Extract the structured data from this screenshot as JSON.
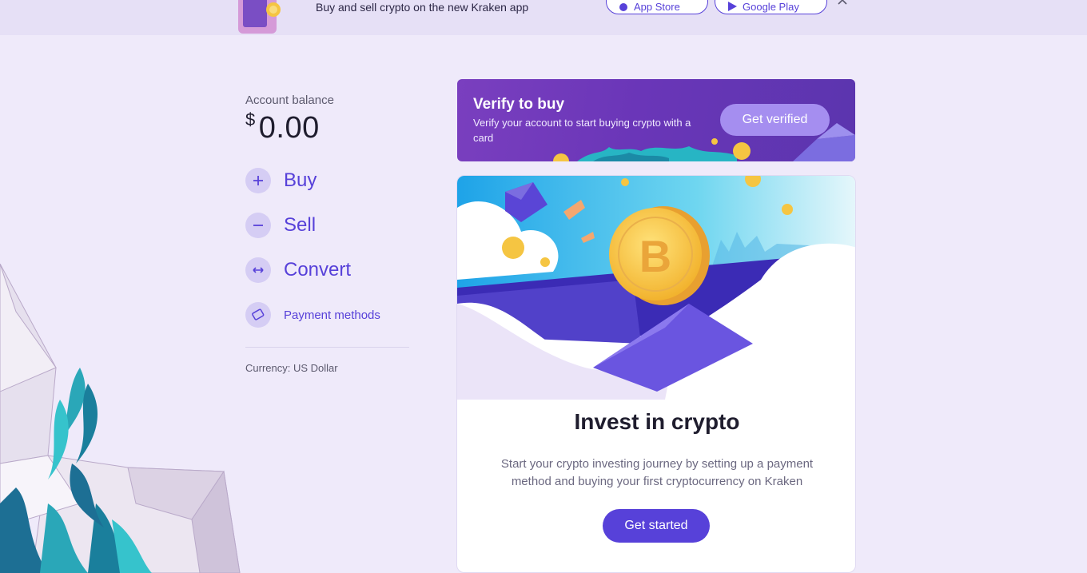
{
  "banner": {
    "text": "Buy and sell crypto on the new Kraken app",
    "app_store_label": "App Store",
    "google_play_label": "Google Play"
  },
  "account": {
    "label": "Account balance",
    "currency_symbol": "$",
    "balance": "0.00",
    "currency_note": "Currency: US Dollar"
  },
  "actions": {
    "buy": "Buy",
    "sell": "Sell",
    "convert": "Convert",
    "payment_methods": "Payment methods"
  },
  "verify": {
    "title": "Verify to buy",
    "subtitle": "Verify your account to start buying crypto with a card",
    "button": "Get verified"
  },
  "invest": {
    "title": "Invest in crypto",
    "description": "Start your crypto investing journey by setting up a payment method and buying your first cryptocurrency on Kraken",
    "button": "Get started"
  },
  "colors": {
    "accent": "#5741d9",
    "background": "#efeafa",
    "verify_gradient_start": "#7a3fbf",
    "verify_button": "#a58ef0"
  },
  "icons": [
    "phone-card-icon",
    "apple-icon",
    "google-play-icon",
    "close-icon",
    "plus-icon",
    "minus-icon",
    "swap-arrows-icon",
    "card-icon",
    "bitcoin-coin-icon"
  ]
}
